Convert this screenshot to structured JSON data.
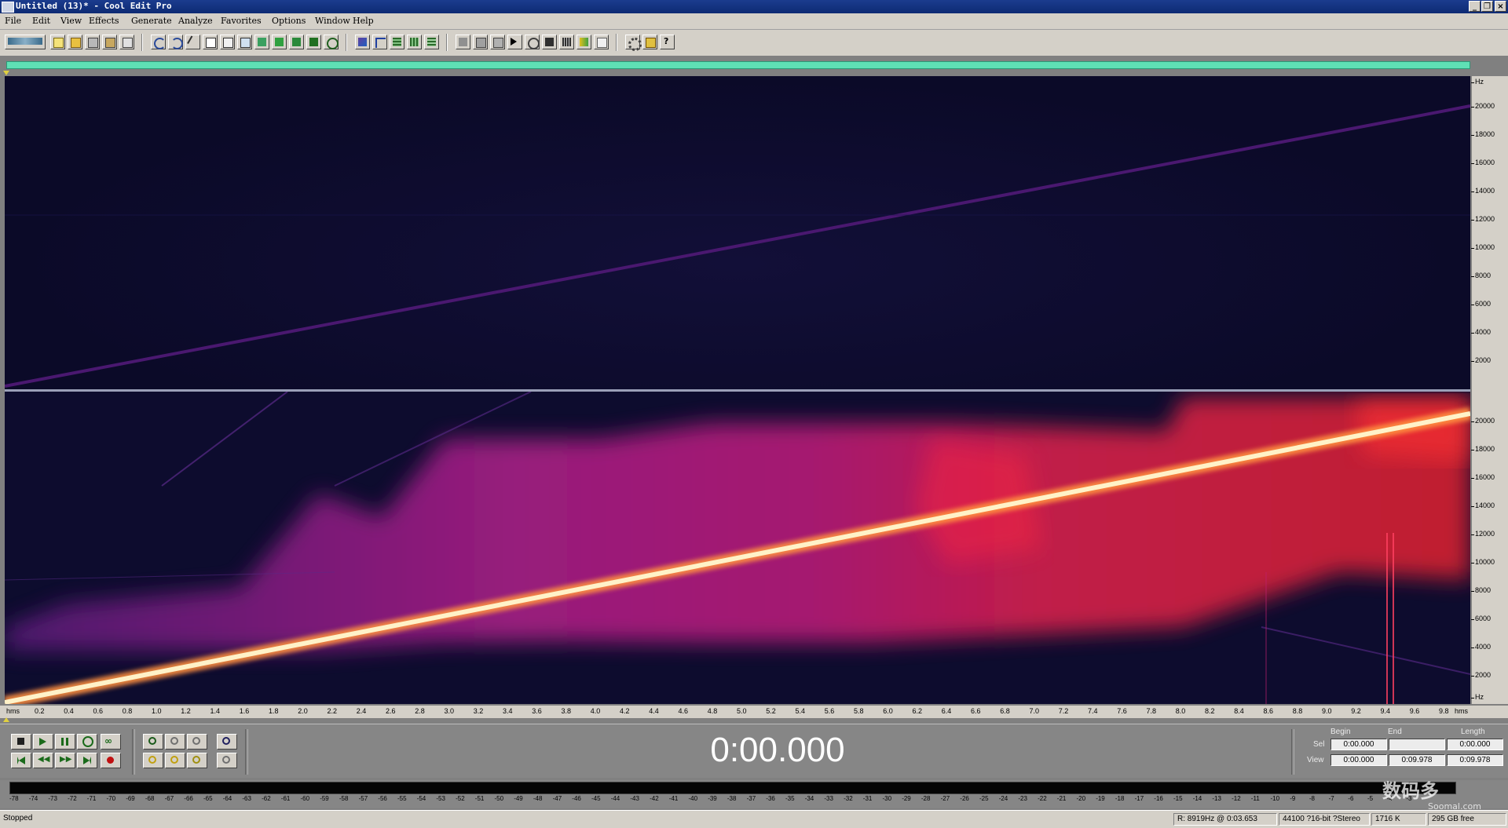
{
  "window": {
    "title": "Untitled (13)* - Cool Edit Pro",
    "controls": [
      "minimize",
      "restore",
      "close"
    ]
  },
  "menu": [
    "File",
    "Edit",
    "View",
    "Effects",
    "Generate",
    "Analyze",
    "Favorites",
    "Options",
    "Window",
    "Help"
  ],
  "toolbar": {
    "buttons": [
      "multitrack-toggle-icon",
      "new-icon",
      "open-icon",
      "save-icon",
      "save-as-icon",
      "close-file-icon",
      "undo-icon",
      "redo-icon",
      "cut-icon",
      "copy-icon",
      "paste-icon",
      "mix-paste-icon",
      "trim-icon",
      "mark-icon",
      "snap-icon",
      "loop-icon",
      "waveform-view-icon",
      "spectral-view-icon",
      "spectral-pitch-icon",
      "cue-list-icon",
      "play-list-icon",
      "channel-icon",
      "phase-icon",
      "pan-icon",
      "frequency-analysis-icon",
      "statistics-icon",
      "batch-icon",
      "tone-icon",
      "noise-icon",
      "settings-icon",
      "favorites-icon",
      "help-icon"
    ]
  },
  "spectrogram": {
    "hz_labels_top": [
      "Hz",
      "20000",
      "18000",
      "16000",
      "14000",
      "12000",
      "10000",
      "8000",
      "6000",
      "4000",
      "2000"
    ],
    "hz_labels_bottom": [
      "20000",
      "18000",
      "16000",
      "14000",
      "12000",
      "10000",
      "8000",
      "6000",
      "4000",
      "2000",
      "Hz"
    ],
    "colors": {
      "background": "#0c0b2b",
      "sweep_top": "#4a1870",
      "sweep_bottom": "#fff2c8",
      "noise": "#e0207a"
    }
  },
  "time_ruler": {
    "unit": "hms",
    "ticks": [
      "0.2",
      "0.4",
      "0.6",
      "0.8",
      "1.0",
      "1.2",
      "1.4",
      "1.6",
      "1.8",
      "2.0",
      "2.2",
      "2.4",
      "2.6",
      "2.8",
      "3.0",
      "3.2",
      "3.4",
      "3.6",
      "3.8",
      "4.0",
      "4.2",
      "4.4",
      "4.6",
      "4.8",
      "5.0",
      "5.2",
      "5.4",
      "5.6",
      "5.8",
      "6.0",
      "6.2",
      "6.4",
      "6.6",
      "6.8",
      "7.0",
      "7.2",
      "7.4",
      "7.6",
      "7.8",
      "8.0",
      "8.2",
      "8.4",
      "8.6",
      "8.8",
      "9.0",
      "9.2",
      "9.4",
      "9.6",
      "9.8"
    ]
  },
  "transport": {
    "row1": [
      "stop-icon",
      "play-icon",
      "pause-icon",
      "play-to-end-icon",
      "loop-play-icon"
    ],
    "row2": [
      "go-to-start-icon",
      "rewind-icon",
      "fast-forward-icon",
      "go-to-end-icon",
      "record-icon"
    ],
    "zoom": [
      "zoom-in-horizontal-icon",
      "zoom-out-horizontal-icon",
      "zoom-full-icon",
      "zoom-in-vertical-icon",
      "zoom-to-left-icon",
      "zoom-to-right-icon",
      "zoom-selection-icon",
      "zoom-out-vertical-icon"
    ],
    "time_display": "0:00.000"
  },
  "selection": {
    "headers": {
      "begin": "Begin",
      "end": "End",
      "length": "Length"
    },
    "sel": {
      "label": "Sel",
      "begin": "0:00.000",
      "end": "",
      "length": "0:00.000"
    },
    "view": {
      "label": "View",
      "begin": "0:00.000",
      "end": "0:09.978",
      "length": "0:09.978"
    }
  },
  "level_meter": {
    "labels": [
      "-78",
      "-74",
      "-73",
      "-72",
      "-71",
      "-70",
      "-69",
      "-68",
      "-67",
      "-66",
      "-65",
      "-64",
      "-63",
      "-62",
      "-61",
      "-60",
      "-59",
      "-58",
      "-57",
      "-56",
      "-55",
      "-54",
      "-53",
      "-52",
      "-51",
      "-50",
      "-49",
      "-48",
      "-47",
      "-46",
      "-45",
      "-44",
      "-43",
      "-42",
      "-41",
      "-40",
      "-39",
      "-38",
      "-37",
      "-36",
      "-35",
      "-34",
      "-33",
      "-32",
      "-31",
      "-30",
      "-29",
      "-28",
      "-27",
      "-26",
      "-25",
      "-24",
      "-23",
      "-22",
      "-21",
      "-20",
      "-19",
      "-18",
      "-17",
      "-16",
      "-15",
      "-14",
      "-13",
      "-12",
      "-11",
      "-10",
      "-9",
      "-8",
      "-7",
      "-6",
      "-5",
      "-4",
      "-3"
    ]
  },
  "status": {
    "state": "Stopped",
    "cursor": "R: 8919Hz @   0:03.653",
    "format": "44100 ?16-bit ?Stereo",
    "size": "1716 K",
    "free": "295 GB free"
  },
  "watermark": {
    "text": "数码多",
    "sub": "Soomal.com"
  }
}
